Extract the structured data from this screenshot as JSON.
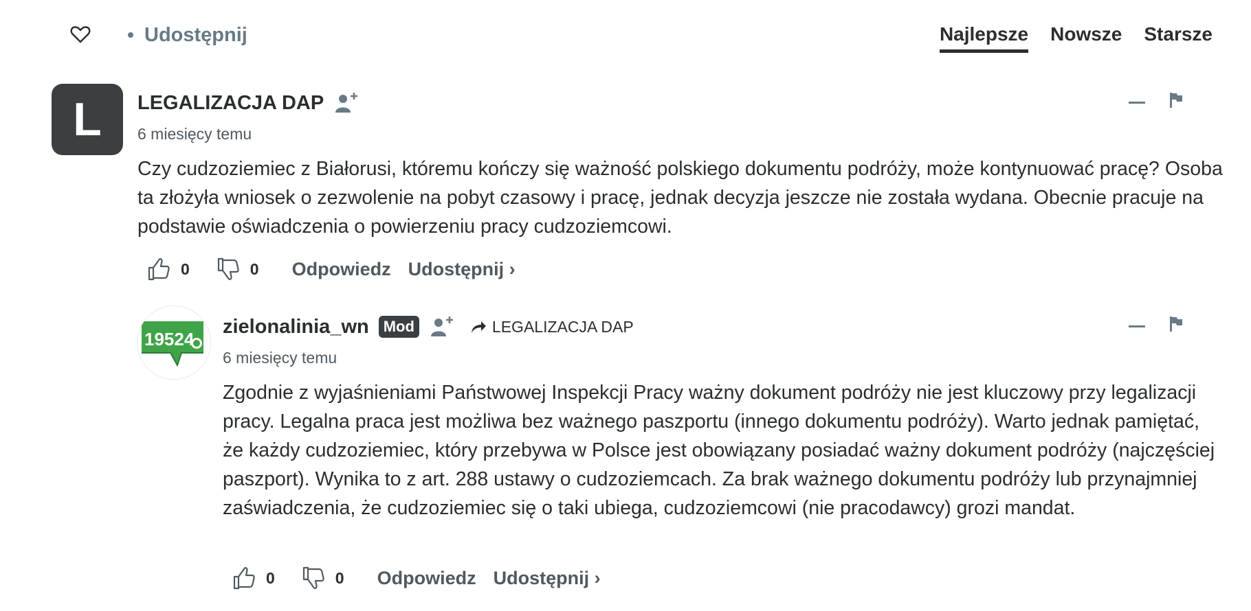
{
  "topbar": {
    "favorite_icon": "heart-outline-icon",
    "share_label": "Udostępnij",
    "sort_tabs": [
      {
        "label": "Najlepsze",
        "active": true
      },
      {
        "label": "Nowsze",
        "active": false
      },
      {
        "label": "Starsze",
        "active": false
      }
    ]
  },
  "comments": [
    {
      "avatar_letter": "L",
      "author": "LEGALIZACJA DAP",
      "time": "6 miesięcy temu",
      "body": "Czy cudzoziemiec z Białorusi, któremu kończy się ważność polskiego dokumentu podróży, może kontynuować pracę? Osoba ta złożyła wniosek o zezwolenie na pobyt czasowy i pracę, jednak decyzja jeszcze nie została wydana. Obecnie pracuje na podstawie oświadczenia o powierzeniu pracy cudzoziemcowi.",
      "upvotes": "0",
      "downvotes": "0",
      "reply_label": "Odpowiedz",
      "share_label": "Udostępnij ›"
    },
    {
      "avatar_logo_text": "19524",
      "author": "zielonalinia_wn",
      "badge": "Mod",
      "reply_to": "LEGALIZACJA DAP",
      "time": "6 miesięcy temu",
      "body": "Zgodnie z wyjaśnieniami Państwowej Inspekcji Pracy ważny dokument podróży nie jest kluczowy przy legalizacji pracy. Legalna praca jest możliwa bez ważnego paszportu (innego dokumentu podróży). Warto jednak pamiętać, że każdy cudzoziemiec, który przebywa w Polsce jest obowiązany posiadać ważny dokument podróży (najczęściej paszport). Wynika to z art. 288 ustawy o cudzoziemcach. Za brak ważnego dokumentu podróży lub przynajmniej zaświadczenia, że cudzoziemiec się o taki ubiega, cudzoziemcowi (nie pracodawcy) grozi mandat.",
      "upvotes": "0",
      "downvotes": "0",
      "reply_label": "Odpowiedz",
      "share_label": "Udostępnij ›"
    }
  ],
  "colors": {
    "text": "#2a2e2e",
    "muted": "#687a86",
    "avatar_dark": "#3b3f41",
    "logo_green": "#3fa447"
  }
}
